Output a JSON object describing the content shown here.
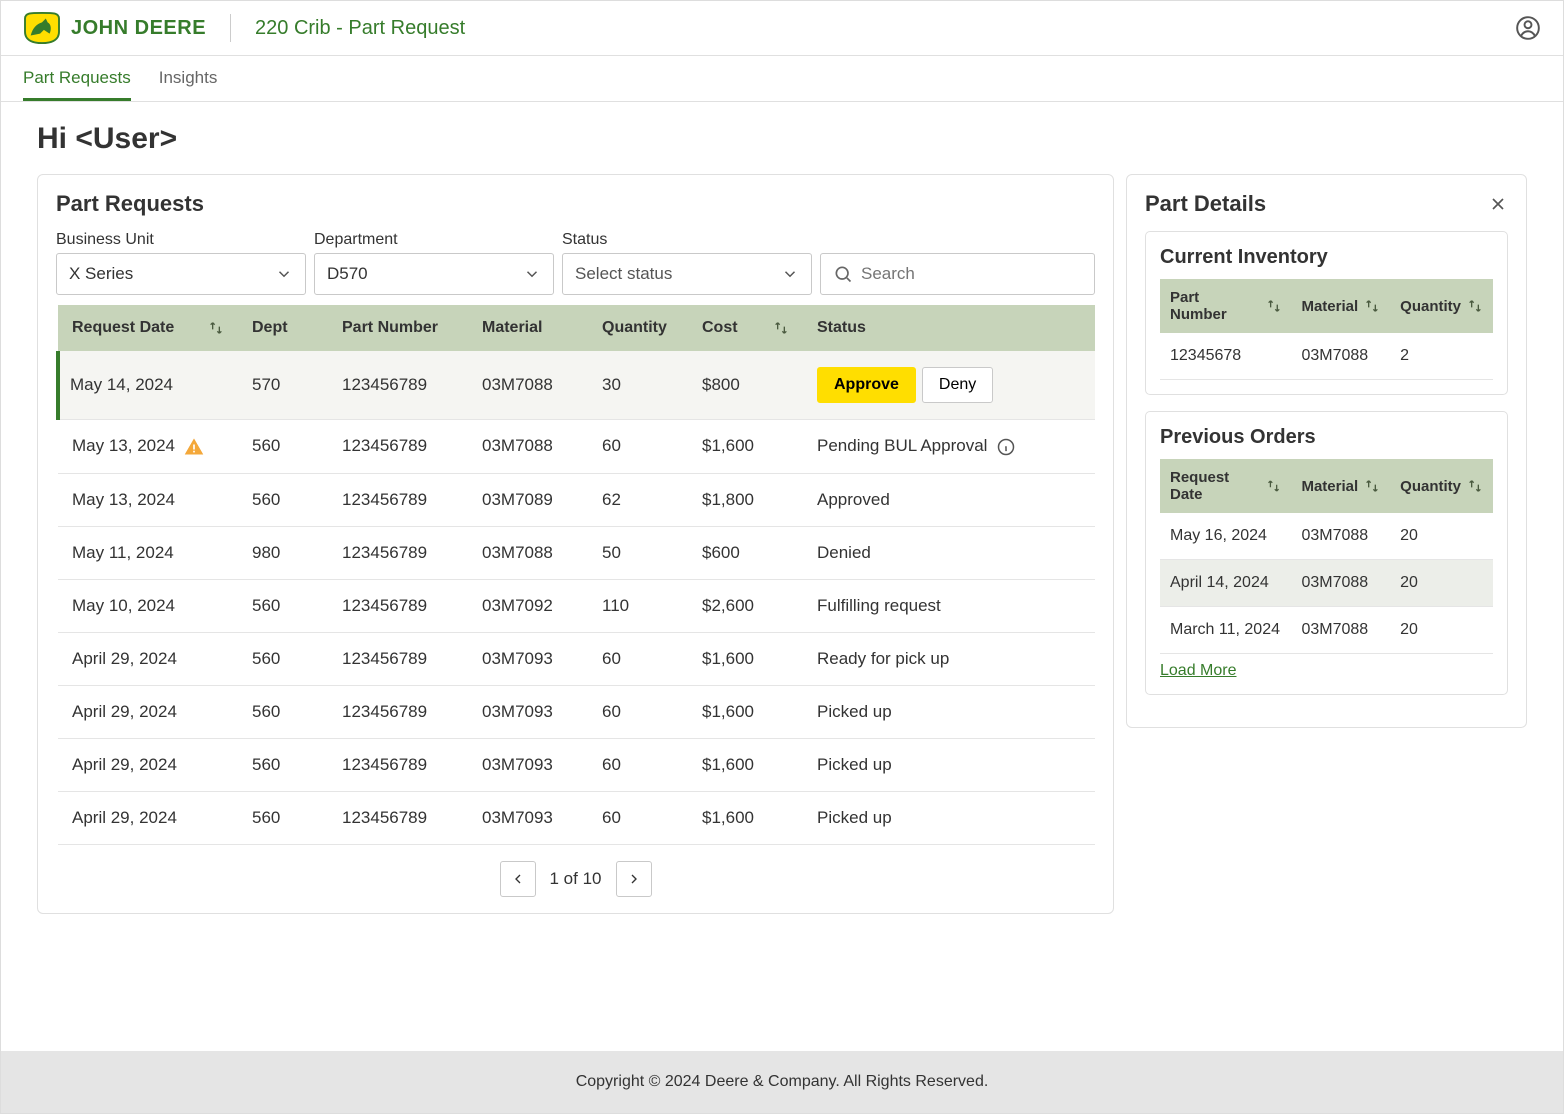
{
  "header": {
    "brand": "JOHN DEERE",
    "app_title": "220 Crib - Part Request"
  },
  "tabs": [
    {
      "label": "Part Requests",
      "active": true
    },
    {
      "label": "Insights",
      "active": false
    }
  ],
  "greeting": "Hi <User>",
  "part_requests": {
    "title": "Part Requests",
    "filters": {
      "business_unit": {
        "label": "Business Unit",
        "value": "X Series"
      },
      "department": {
        "label": "Department",
        "value": "D570"
      },
      "status": {
        "label": "Status",
        "placeholder": "Select status"
      },
      "search_placeholder": "Search"
    },
    "columns": [
      "Request Date",
      "Dept",
      "Part Number",
      "Material",
      "Quantity",
      "Cost",
      "Status"
    ],
    "approve_label": "Approve",
    "deny_label": "Deny",
    "rows": [
      {
        "date": "May 14, 2024",
        "dept": "570",
        "part": "123456789",
        "material": "03M7088",
        "qty": "30",
        "cost": "$800",
        "status": "action",
        "warn": false
      },
      {
        "date": "May 13, 2024",
        "dept": "560",
        "part": "123456789",
        "material": "03M7088",
        "qty": "60",
        "cost": "$1,600",
        "status": "Pending BUL Approval",
        "warn": true,
        "info": true
      },
      {
        "date": "May 13, 2024",
        "dept": "560",
        "part": "123456789",
        "material": "03M7089",
        "qty": "62",
        "cost": "$1,800",
        "status": "Approved"
      },
      {
        "date": "May 11, 2024",
        "dept": "980",
        "part": "123456789",
        "material": "03M7088",
        "qty": "50",
        "cost": "$600",
        "status": "Denied"
      },
      {
        "date": "May 10, 2024",
        "dept": "560",
        "part": "123456789",
        "material": "03M7092",
        "qty": "110",
        "cost": "$2,600",
        "status": "Fulfilling request"
      },
      {
        "date": "April 29, 2024",
        "dept": "560",
        "part": "123456789",
        "material": "03M7093",
        "qty": "60",
        "cost": "$1,600",
        "status": "Ready for pick up"
      },
      {
        "date": "April 29, 2024",
        "dept": "560",
        "part": "123456789",
        "material": "03M7093",
        "qty": "60",
        "cost": "$1,600",
        "status": "Picked up"
      },
      {
        "date": "April 29, 2024",
        "dept": "560",
        "part": "123456789",
        "material": "03M7093",
        "qty": "60",
        "cost": "$1,600",
        "status": "Picked up"
      },
      {
        "date": "April 29, 2024",
        "dept": "560",
        "part": "123456789",
        "material": "03M7093",
        "qty": "60",
        "cost": "$1,600",
        "status": "Picked up"
      }
    ],
    "pager": "1 of 10"
  },
  "part_details": {
    "title": "Part Details",
    "current_inventory": {
      "title": "Current Inventory",
      "columns": [
        "Part Number",
        "Material",
        "Quantity"
      ],
      "rows": [
        {
          "part": "12345678",
          "material": "03M7088",
          "qty": "2"
        }
      ]
    },
    "previous_orders": {
      "title": "Previous Orders",
      "columns": [
        "Request Date",
        "Material",
        "Quantity"
      ],
      "rows": [
        {
          "date": "May 16, 2024",
          "material": "03M7088",
          "qty": "20"
        },
        {
          "date": "April 14, 2024",
          "material": "03M7088",
          "qty": "20"
        },
        {
          "date": "March 11, 2024",
          "material": "03M7088",
          "qty": "20"
        }
      ],
      "load_more": "Load More"
    }
  },
  "footer": "Copyright © 2024 Deere & Company. All Rights Reserved."
}
